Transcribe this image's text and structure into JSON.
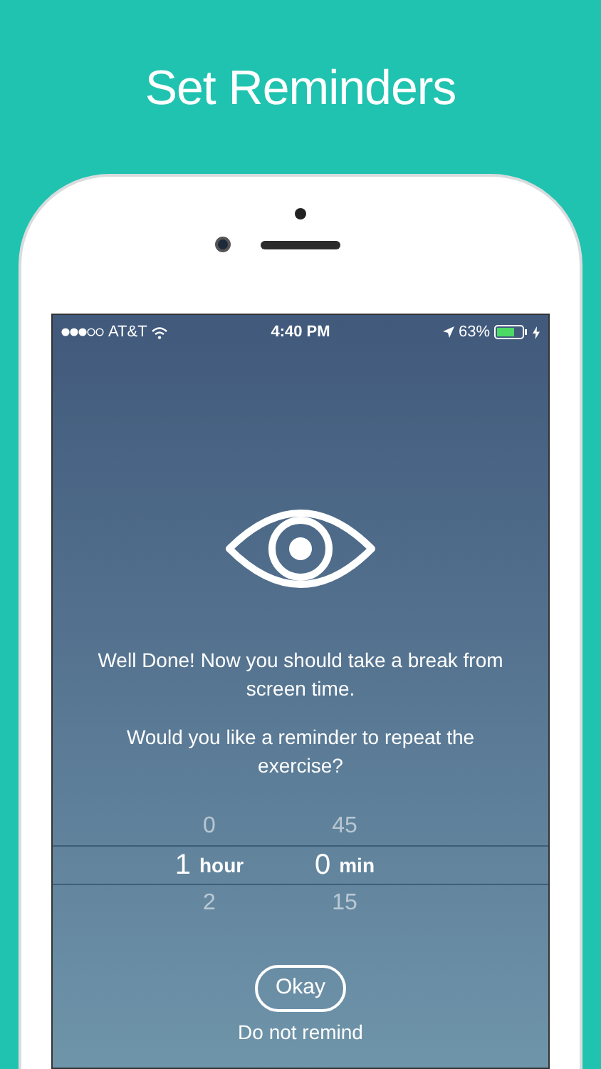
{
  "header": {
    "title": "Set Reminders"
  },
  "status_bar": {
    "carrier": "AT&T",
    "time": "4:40 PM",
    "battery": "63%"
  },
  "message": "Well Done! Now you should take a break from screen time.",
  "question": "Would you like a reminder to repeat the exercise?",
  "picker": {
    "columns": [
      {
        "unit": "hour",
        "options": [
          {
            "value": "0",
            "selected": false
          },
          {
            "value": "1",
            "selected": true
          },
          {
            "value": "2",
            "selected": false
          }
        ]
      },
      {
        "unit": "min",
        "options": [
          {
            "value": "45",
            "selected": false
          },
          {
            "value": "0",
            "selected": true
          },
          {
            "value": "15",
            "selected": false
          }
        ]
      }
    ]
  },
  "buttons": [
    {
      "label": "Okay",
      "kind": "outlined"
    },
    {
      "label": "Do not remind",
      "kind": "plain"
    }
  ]
}
